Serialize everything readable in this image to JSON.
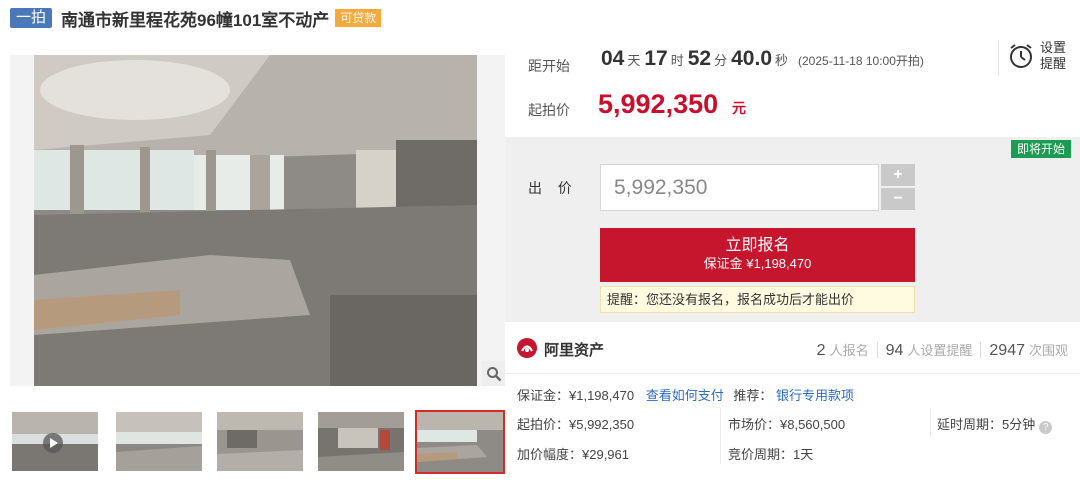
{
  "header": {
    "round_tag": "一拍",
    "title": "南通市新里程花苑96幢101室不动产",
    "loan_tag": "可贷款"
  },
  "countdown": {
    "label": "距开始",
    "days": "04",
    "days_unit": "天",
    "hours": "17",
    "hours_unit": "时",
    "minutes": "52",
    "minutes_unit": "分",
    "seconds": "40.0",
    "seconds_unit": "秒",
    "start_time": "(2025-11-18 10:00开拍)"
  },
  "start_price": {
    "label": "起拍价",
    "value": "5,992,350",
    "unit": "元"
  },
  "reminder_setting": {
    "label_line1": "设置",
    "label_line2": "提醒",
    "icon": "alarm-clock-icon"
  },
  "bid": {
    "status_badge": "即将开始",
    "label": "出 价",
    "input_value": "5,992,350",
    "plus": "+",
    "minus": "−",
    "register_label": "立即报名",
    "deposit_line": "保证金 ¥1,198,470",
    "notice": "提醒：您还没有报名，报名成功后才能出价"
  },
  "platform": {
    "name": "阿里资产",
    "stats": [
      {
        "count": "2",
        "label": "人报名"
      },
      {
        "count": "94",
        "label": "人设置提醒"
      },
      {
        "count": "2947",
        "label": "次围观"
      }
    ]
  },
  "details": {
    "deposit": "保证金：¥1,198,470",
    "how_to_pay": "查看如何支付",
    "recommend_label": "推荐：",
    "recommend_link": "银行专用款项",
    "start_price": "起拍价：¥5,992,350",
    "market_price": "市场价：¥8,560,500",
    "delay_period": "延时周期：5分钟",
    "increment": "加价幅度：¥29,961",
    "bid_period": "竞价周期：1天"
  },
  "colors": {
    "accent_red": "#c5162e",
    "tag_blue": "#4a78b8",
    "loan_orange": "#f7a93b",
    "badge_green": "#1d9b52",
    "link_blue": "#2a6bc4"
  }
}
